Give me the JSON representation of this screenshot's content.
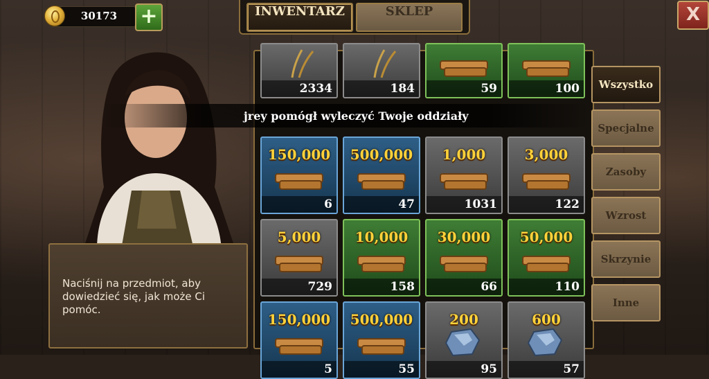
{
  "currency": {
    "amount": "30173",
    "icon": "gold-coin-icon",
    "add_icon": "plus-icon"
  },
  "tabs": [
    {
      "label": "INWENTARZ",
      "active": true
    },
    {
      "label": "SKLEP",
      "active": false
    }
  ],
  "close_label": "X",
  "notification": "jrey pomógł wyleczyć Twoje oddziały",
  "info_text": "Naciśnij na przedmiot, aby dowiedzieć się, jak może Ci pomóc.",
  "categories": [
    {
      "label": "Wszystko",
      "active": true
    },
    {
      "label": "Specjalne"
    },
    {
      "label": "Zasoby"
    },
    {
      "label": "Wzrost"
    },
    {
      "label": "Skrzynie"
    },
    {
      "label": "Inne"
    }
  ],
  "items": [
    {
      "amount": "",
      "count": "2334",
      "rarity": "gray",
      "icon": "wheat-icon"
    },
    {
      "amount": "",
      "count": "184",
      "rarity": "gray",
      "icon": "wheat-bundle-icon"
    },
    {
      "amount": "",
      "count": "59",
      "rarity": "green",
      "icon": "grain-sack-icon"
    },
    {
      "amount": "",
      "count": "100",
      "rarity": "green",
      "icon": "grain-sacks-icon"
    },
    {
      "amount": "150,000",
      "count": "6",
      "rarity": "blue",
      "icon": "grain-sacks-icon"
    },
    {
      "amount": "500,000",
      "count": "47",
      "rarity": "blue",
      "icon": "grain-cart-icon"
    },
    {
      "amount": "1,000",
      "count": "1031",
      "rarity": "gray",
      "icon": "wood-plank-icon"
    },
    {
      "amount": "3,000",
      "count": "122",
      "rarity": "gray",
      "icon": "wood-planks-icon"
    },
    {
      "amount": "5,000",
      "count": "729",
      "rarity": "gray",
      "icon": "wood-stack-icon"
    },
    {
      "amount": "10,000",
      "count": "158",
      "rarity": "green",
      "icon": "wood-bundle-icon"
    },
    {
      "amount": "30,000",
      "count": "66",
      "rarity": "green",
      "icon": "wood-bundles-icon"
    },
    {
      "amount": "50,000",
      "count": "110",
      "rarity": "green",
      "icon": "wood-pile-icon"
    },
    {
      "amount": "150,000",
      "count": "5",
      "rarity": "blue",
      "icon": "log-pile-icon"
    },
    {
      "amount": "500,000",
      "count": "55",
      "rarity": "blue",
      "icon": "wood-cart-icon"
    },
    {
      "amount": "200",
      "count": "95",
      "rarity": "gray",
      "icon": "stone-icon"
    },
    {
      "amount": "600",
      "count": "57",
      "rarity": "gray",
      "icon": "stones-icon"
    }
  ]
}
